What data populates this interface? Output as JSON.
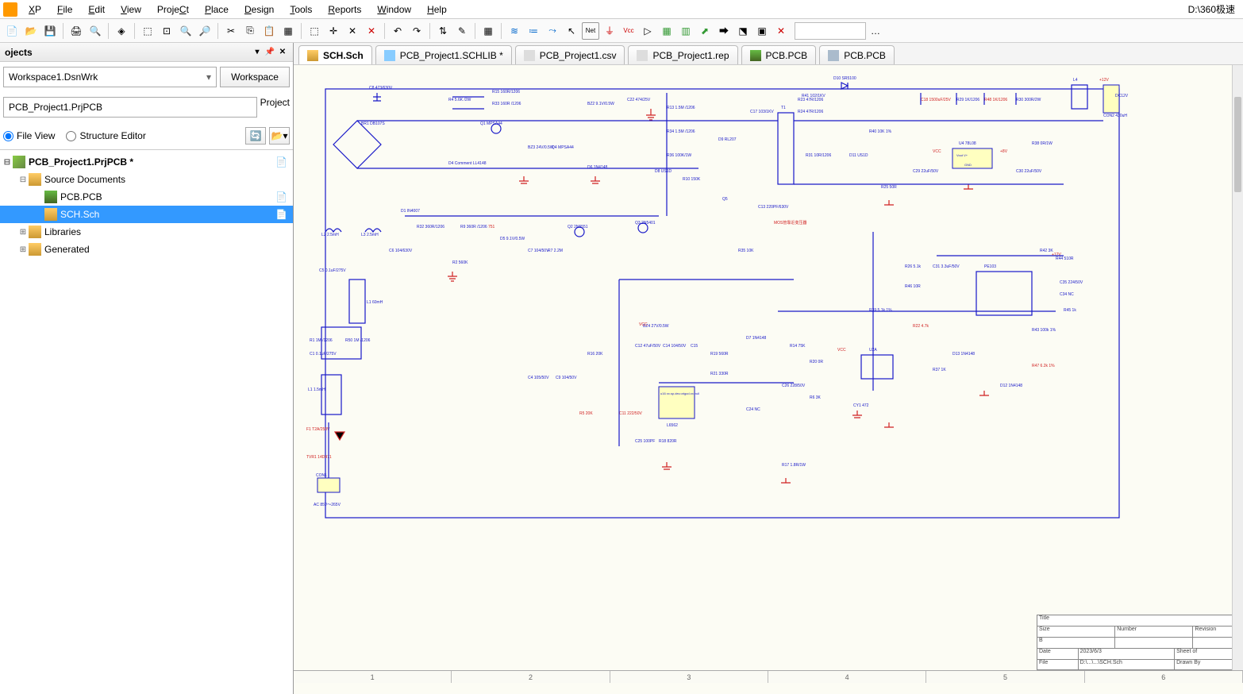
{
  "menu": {
    "items": [
      "DXP",
      "File",
      "Edit",
      "View",
      "Project",
      "Place",
      "Design",
      "Tools",
      "Reports",
      "Window",
      "Help"
    ],
    "accel": [
      "X",
      "F",
      "E",
      "V",
      "C",
      "P",
      "D",
      "T",
      "R",
      "W",
      "H"
    ],
    "path": "D:\\360极速"
  },
  "leftpanel": {
    "title": "ojects",
    "workspace_value": "Workspace1.DsnWrk",
    "workspace_btn": "Workspace",
    "project_value": "PCB_Project1.PrjPCB",
    "project_btn": "Project",
    "view_file": "File View",
    "view_struct": "Structure Editor"
  },
  "tree": {
    "root": "PCB_Project1.PrjPCB *",
    "src": "Source Documents",
    "items": [
      "PCB.PCB",
      "SCH.Sch"
    ],
    "libs": "Libraries",
    "gen": "Generated"
  },
  "tabs": [
    {
      "label": "SCH.Sch",
      "icon": "sch",
      "active": true
    },
    {
      "label": "PCB_Project1.SCHLIB *",
      "icon": "lib"
    },
    {
      "label": "PCB_Project1.csv",
      "icon": "file"
    },
    {
      "label": "PCB_Project1.rep",
      "icon": "file"
    },
    {
      "label": "PCB.PCB",
      "icon": "pcb"
    },
    {
      "label": "PCB.PCB",
      "icon": "pcb2"
    }
  ],
  "titleblock": {
    "rows": [
      [
        "Title",
        ""
      ],
      [
        "Size",
        "Number",
        "Revision"
      ],
      [
        "B",
        "",
        ""
      ],
      [
        "Date",
        "2023/6/3",
        "Sheet  of"
      ],
      [
        "File",
        "D:\\...\\...\\SCH.Sch",
        "Drawn By"
      ]
    ]
  },
  "ruler": [
    "1",
    "2",
    "3",
    "4",
    "5",
    "6"
  ],
  "schematic_labels": {
    "ac_in": "AC 85V～265V",
    "con1": "CON1",
    "tvr1": "TVR1 14D471",
    "f1": "F1 T2A/250V",
    "l1b": "L1 1.5mH",
    "c1": "C1 0.1uF/275V",
    "r1": "R1 1M /1206",
    "r50": "R50 1M /1206",
    "l1": "L1 60mH",
    "c5": "C5 0.1uF/275V",
    "l2": "L2 2.5mH",
    "l3": "L3 2.5mH",
    "c6": "C6 104/630V",
    "br1": "BR1 DB107S",
    "c8": "C8 473/630V",
    "r4": "R4 5.6K /2W",
    "r15": "R15 160R/1206",
    "r33": "R33 160R /1206",
    "q1": "Q1 MPSA44",
    "d4": "D4 Comment LL4148",
    "d1": "D1 IN4007",
    "r32": "R32 360R/1206",
    "r9": "R9 360R /1206",
    "r2": "R2 560K",
    "bz3": "BZ3 24V/0.5W",
    "q4": "Q4 MPSA44",
    "bz2": "BZ2 9.1V/0.5W",
    "d5": "D5 9.1V/0.5W",
    "c22": "C22 474/25V",
    "d6": "D6 1N4148",
    "c7": "C7 104/50V",
    "r7": "R7 2.2M",
    "q2": "Q2 2N5551",
    "q3": "Q3 2N5401",
    "c4": "C4 105/50V",
    "r16": "R16 20K",
    "c9": "C9 104/50V",
    "bz4": "BZ4 27V/0.5W",
    "c12": "C12 47uF/50V",
    "c15": "C15",
    "c14": "C14 104/50V",
    "d7": "D7 1N4148",
    "r19": "R19 560R",
    "r21": "R21 330R",
    "u1": "u16 xx.sp.dev.origod.xx.null",
    "l6562": "L6562",
    "r5": "R5 20K",
    "c11": "C11 222/50V",
    "r18": "R18 820R",
    "c25": "C25 100PF",
    "c24": "C24 NC",
    "r17": "R17 1.8R/1W",
    "c26": "C26 228/50V",
    "r6": "R6 3K",
    "r14": "R14 75K",
    "r20": "R20 0R",
    "q5": "Q5",
    "c13": "C13 220PF/630V",
    "r35": "R35 10K",
    "d9": "D9 RL207",
    "r34": "R34 1.5M /1206",
    "r36": "R36 100K/1W",
    "r10": "R10 150K",
    "c17": "C17 103/1KV",
    "d8": "D8 US1D",
    "r13": "R13 1.5M /1206",
    "t1": "T1",
    "r31": "R31 10R/1206",
    "d11": "D11 US1D",
    "r23": "R23 47R/1206",
    "r24": "R24 47R/1206",
    "d10": "D10 SR5100",
    "c18": "C18 1500uF/25V",
    "r29": "R29 1K/1206",
    "r48": "R48 1K/1206",
    "r30": "R30 300R/2W",
    "r41": "R41 102/1KV",
    "l4": "L4",
    "con2": "CON2 430uH",
    "dc12v": "DC12V",
    "r40": "R40 10K 1%",
    "r25": "R25 50R",
    "c29": "C29 22uF/50V",
    "u4": "U4 78L08",
    "c30": "C30 22uF/50V",
    "r38": "R38 0R/1W",
    "plus8": "+8V",
    "plus12": "+12V",
    "r26": "R26 5.1k",
    "r46": "R46 10R",
    "r39": "R39 5.1k 1%",
    "c31": "C31 3.3uF/50V",
    "r22": "R22 4.7k",
    "cy1": "CY1 472",
    "u2a": "U2A",
    "r37": "R37 1K",
    "d13": "D13 1N4148",
    "d12": "D12 1N4148",
    "r47": "R47 6.2k 1%",
    "r43": "R43 100k 1%",
    "r42": "R42 3K",
    "r44": "R44 510R",
    "c34": "C34 NC",
    "c35": "C35 224/50V",
    "r45": "R45 1k",
    "pf103": "PE103",
    "mos_note": "MOS管靠近变压器",
    "vcc": "VCC",
    "vout": "Vout  V+",
    "gnd": "GND",
    "v751": "751"
  }
}
